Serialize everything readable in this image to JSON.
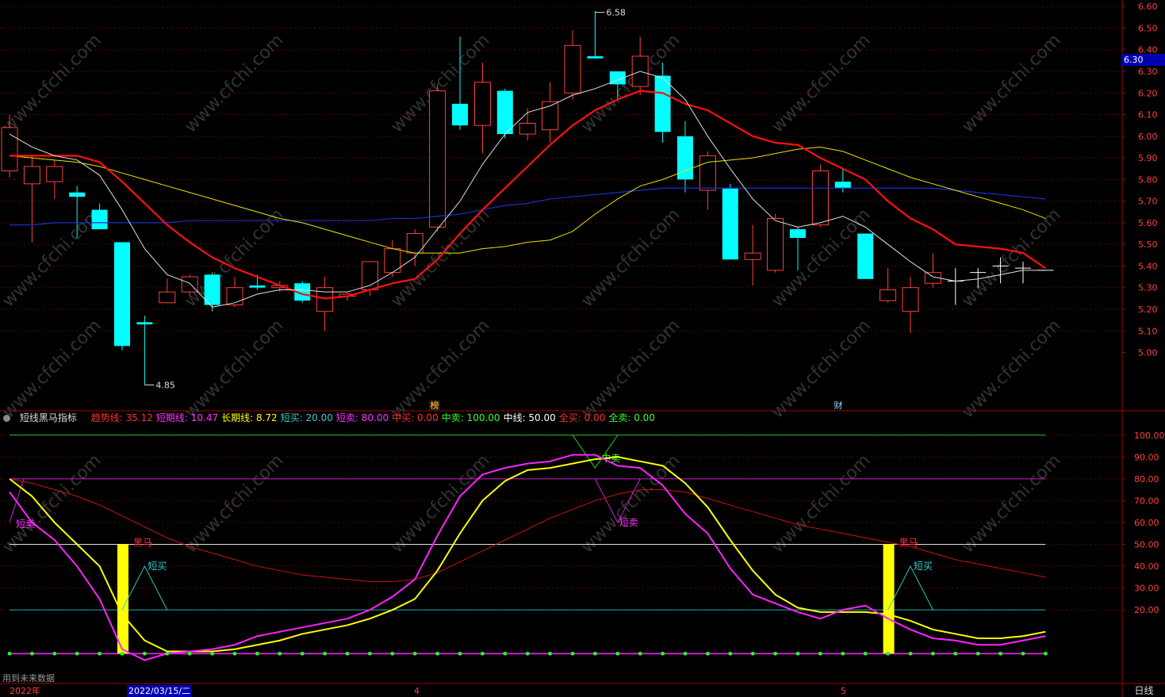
{
  "chart_data": {
    "type": "candlestick",
    "price_axis": {
      "ticks": [
        "5.00",
        "5.10",
        "5.20",
        "5.30",
        "5.40",
        "5.50",
        "5.60",
        "5.70",
        "5.80",
        "5.90",
        "6.00",
        "6.10",
        "6.20",
        "6.30",
        "6.40",
        "6.50",
        "6.60"
      ],
      "ylim": [
        4.76,
        6.63
      ],
      "current_price": "6.30"
    },
    "annotations": {
      "high": "6.58",
      "low": "4.85",
      "markers": [
        "榜",
        "财"
      ]
    },
    "candles": [
      {
        "o": 5.84,
        "c": 6.04,
        "h": 6.1,
        "l": 5.81
      },
      {
        "o": 5.78,
        "c": 5.86,
        "h": 5.91,
        "l": 5.51
      },
      {
        "o": 5.79,
        "c": 5.86,
        "h": 5.89,
        "l": 5.71
      },
      {
        "o": 5.74,
        "c": 5.72,
        "h": 5.77,
        "l": 5.53
      },
      {
        "o": 5.66,
        "c": 5.57,
        "h": 5.69,
        "l": 5.57
      },
      {
        "o": 5.51,
        "c": 5.03,
        "h": 5.51,
        "l": 5.01
      },
      {
        "o": 5.14,
        "c": 5.13,
        "h": 5.17,
        "l": 4.85
      },
      {
        "o": 5.23,
        "c": 5.28,
        "h": 5.34,
        "l": 5.23
      },
      {
        "o": 5.28,
        "c": 5.35,
        "h": 5.36,
        "l": 5.26
      },
      {
        "o": 5.36,
        "c": 5.22,
        "h": 5.37,
        "l": 5.19
      },
      {
        "o": 5.22,
        "c": 5.3,
        "h": 5.35,
        "l": 5.21
      },
      {
        "o": 5.31,
        "c": 5.3,
        "h": 5.36,
        "l": 5.29
      },
      {
        "o": 5.3,
        "c": 5.31,
        "h": 5.33,
        "l": 5.28
      },
      {
        "o": 5.32,
        "c": 5.24,
        "h": 5.33,
        "l": 5.23
      },
      {
        "o": 5.19,
        "c": 5.3,
        "h": 5.35,
        "l": 5.1
      },
      {
        "o": 5.26,
        "c": 5.27,
        "h": 5.28,
        "l": 5.24
      },
      {
        "o": 5.29,
        "c": 5.42,
        "h": 5.42,
        "l": 5.26
      },
      {
        "o": 5.37,
        "c": 5.48,
        "h": 5.52,
        "l": 5.35
      },
      {
        "o": 5.46,
        "c": 5.55,
        "h": 5.57,
        "l": 5.4
      },
      {
        "o": 5.58,
        "c": 6.21,
        "h": 6.24,
        "l": 5.56
      },
      {
        "o": 6.15,
        "c": 6.05,
        "h": 6.46,
        "l": 6.03
      },
      {
        "o": 6.05,
        "c": 6.25,
        "h": 6.34,
        "l": 5.92
      },
      {
        "o": 6.21,
        "c": 6.01,
        "h": 6.22,
        "l": 5.99
      },
      {
        "o": 6.01,
        "c": 6.06,
        "h": 6.13,
        "l": 5.98
      },
      {
        "o": 6.03,
        "c": 6.16,
        "h": 6.25,
        "l": 5.97
      },
      {
        "o": 6.2,
        "c": 6.42,
        "h": 6.49,
        "l": 6.17
      },
      {
        "o": 6.37,
        "c": 6.36,
        "h": 6.58,
        "l": 6.36
      },
      {
        "o": 6.3,
        "c": 6.24,
        "h": 6.3,
        "l": 6.17
      },
      {
        "o": 6.23,
        "c": 6.37,
        "h": 6.46,
        "l": 6.19
      },
      {
        "o": 6.28,
        "c": 6.02,
        "h": 6.34,
        "l": 5.97
      },
      {
        "o": 6.0,
        "c": 5.8,
        "h": 6.07,
        "l": 5.74
      },
      {
        "o": 5.75,
        "c": 5.91,
        "h": 5.93,
        "l": 5.66
      },
      {
        "o": 5.76,
        "c": 5.43,
        "h": 5.78,
        "l": 5.43
      },
      {
        "o": 5.43,
        "c": 5.46,
        "h": 5.59,
        "l": 5.31
      },
      {
        "o": 5.38,
        "c": 5.62,
        "h": 5.64,
        "l": 5.37
      },
      {
        "o": 5.57,
        "c": 5.53,
        "h": 5.58,
        "l": 5.38
      },
      {
        "o": 5.59,
        "c": 5.84,
        "h": 5.87,
        "l": 5.58
      },
      {
        "o": 5.79,
        "c": 5.76,
        "h": 5.85,
        "l": 5.74
      },
      {
        "o": 5.55,
        "c": 5.34,
        "h": 5.55,
        "l": 5.34
      },
      {
        "o": 5.24,
        "c": 5.29,
        "h": 5.39,
        "l": 5.23
      },
      {
        "o": 5.19,
        "c": 5.3,
        "h": 5.35,
        "l": 5.09
      },
      {
        "o": 5.32,
        "c": 5.37,
        "h": 5.46,
        "l": 5.3
      },
      {
        "o": 5.33,
        "c": 5.33,
        "h": 5.39,
        "l": 5.22
      },
      {
        "o": 5.35,
        "c": 5.37,
        "h": 5.39,
        "l": 5.3
      },
      {
        "o": 5.4,
        "c": 5.4,
        "h": 5.44,
        "l": 5.32
      },
      {
        "o": 5.39,
        "c": 5.39,
        "h": 5.42,
        "l": 5.32
      },
      {
        "o": 5.38,
        "c": 5.38,
        "h": 5.38,
        "l": 5.38
      }
    ],
    "ma_white": [
      6.01,
      5.95,
      5.91,
      5.89,
      5.82,
      5.66,
      5.48,
      5.36,
      5.32,
      5.21,
      5.23,
      5.27,
      5.29,
      5.29,
      5.28,
      5.28,
      5.31,
      5.37,
      5.44,
      5.57,
      5.7,
      5.87,
      6.01,
      6.11,
      6.14,
      6.19,
      6.22,
      6.26,
      6.3,
      6.27,
      6.17,
      6.0,
      5.85,
      5.71,
      5.61,
      5.58,
      5.6,
      5.63,
      5.58,
      5.5,
      5.42,
      5.35,
      5.33,
      5.34,
      5.36,
      5.38,
      5.38
    ],
    "ma_red": [
      5.91,
      5.91,
      5.91,
      5.91,
      5.88,
      5.79,
      5.69,
      5.59,
      5.51,
      5.44,
      5.39,
      5.35,
      5.31,
      5.27,
      5.25,
      5.26,
      5.29,
      5.32,
      5.34,
      5.43,
      5.55,
      5.66,
      5.76,
      5.86,
      5.96,
      6.05,
      6.12,
      6.17,
      6.21,
      6.2,
      6.15,
      6.12,
      6.06,
      6.0,
      5.97,
      5.96,
      5.9,
      5.85,
      5.8,
      5.7,
      5.62,
      5.57,
      5.5,
      5.49,
      5.48,
      5.46,
      5.39
    ],
    "ma_yellow": [
      5.91,
      5.9,
      5.89,
      5.88,
      5.86,
      5.83,
      5.8,
      5.77,
      5.74,
      5.71,
      5.68,
      5.65,
      5.62,
      5.6,
      5.57,
      5.54,
      5.51,
      5.48,
      5.46,
      5.46,
      5.46,
      5.48,
      5.49,
      5.51,
      5.52,
      5.56,
      5.64,
      5.71,
      5.77,
      5.8,
      5.84,
      5.88,
      5.89,
      5.9,
      5.92,
      5.94,
      5.95,
      5.93,
      5.89,
      5.85,
      5.81,
      5.78,
      5.75,
      5.72,
      5.69,
      5.66,
      5.62
    ],
    "ma_blue": [
      5.59,
      5.59,
      5.6,
      5.6,
      5.6,
      5.6,
      5.6,
      5.6,
      5.61,
      5.61,
      5.61,
      5.61,
      5.61,
      5.61,
      5.61,
      5.61,
      5.61,
      5.62,
      5.62,
      5.63,
      5.64,
      5.66,
      5.68,
      5.69,
      5.71,
      5.72,
      5.73,
      5.74,
      5.75,
      5.76,
      5.76,
      5.76,
      5.76,
      5.76,
      5.76,
      5.76,
      5.76,
      5.76,
      5.76,
      5.76,
      5.76,
      5.76,
      5.75,
      5.74,
      5.73,
      5.72,
      5.71
    ],
    "indicator": {
      "name": "短线黑马指标",
      "ylim": [
        -1,
        105
      ],
      "ticks": [
        "20.00",
        "30.00",
        "40.00",
        "50.00",
        "60.00",
        "70.00",
        "80.00",
        "90.00",
        "100.00"
      ],
      "trend_line": [
        80,
        78,
        75,
        72,
        68,
        63,
        58,
        53,
        49,
        46,
        43,
        40,
        38,
        36,
        35,
        34,
        33,
        33,
        34,
        37,
        42,
        47,
        52,
        57,
        62,
        66,
        70,
        73,
        75,
        75,
        74,
        71,
        68,
        65,
        62,
        59,
        57,
        55,
        53,
        51,
        49,
        46,
        43,
        41,
        39,
        37,
        35
      ],
      "short_line": [
        74,
        60,
        52,
        40,
        25,
        2,
        -3,
        0,
        1,
        2,
        4,
        8,
        10,
        12,
        14,
        16,
        20,
        26,
        34,
        54,
        72,
        82,
        85,
        87,
        88,
        91,
        91,
        86,
        85,
        77,
        64,
        55,
        39,
        27,
        23,
        19,
        16,
        20,
        22,
        16,
        11,
        7,
        6,
        4,
        4,
        6,
        8
      ],
      "long_line": [
        80,
        72,
        60,
        50,
        40,
        18,
        6,
        1,
        1,
        1,
        2,
        4,
        6,
        9,
        11,
        13,
        16,
        20,
        25,
        38,
        55,
        70,
        79,
        84,
        85,
        87,
        89,
        90,
        88,
        86,
        78,
        67,
        52,
        38,
        27,
        21,
        19,
        19,
        19,
        18,
        15,
        11,
        9,
        7,
        7,
        8,
        10
      ],
      "hline_values": [
        100,
        80,
        50,
        20,
        0
      ],
      "signals": [
        "短卖",
        "黑马",
        "短买",
        "中卖",
        "短卖",
        "黑马",
        "短买"
      ]
    }
  },
  "header": {
    "indicator_name": "短线黑马指标",
    "items": [
      {
        "label": "趋势线:",
        "value": "35.12",
        "color": "#ff3030"
      },
      {
        "label": "短期线:",
        "value": "10.47",
        "color": "#ff33ff"
      },
      {
        "label": "长期线:",
        "value": "8.72",
        "color": "#ffff00"
      },
      {
        "label": "短买:",
        "value": "20.00",
        "color": "#33cccc"
      },
      {
        "label": "短卖:",
        "value": "80.00",
        "color": "#ff33ff"
      },
      {
        "label": "中买:",
        "value": "0.00",
        "color": "#ff3030"
      },
      {
        "label": "中卖:",
        "value": "100.00",
        "color": "#33ff33"
      },
      {
        "label": "中线:",
        "value": "50.00",
        "color": "#ffffff"
      },
      {
        "label": "全买:",
        "value": "0.00",
        "color": "#ff3030"
      },
      {
        "label": "全卖:",
        "value": "0.00",
        "color": "#33ff33"
      }
    ]
  },
  "footer": {
    "use_future": "用到未来数据",
    "year_label": "2022年",
    "date_label": "2022/03/15/二",
    "month_4": "4",
    "month_5": "5",
    "period": "日线"
  },
  "watermark": "www.cfchi.com",
  "colors": {
    "up": "#ff4040",
    "down": "#00ffff",
    "bg": "#000000",
    "grid": "#8b0000"
  }
}
